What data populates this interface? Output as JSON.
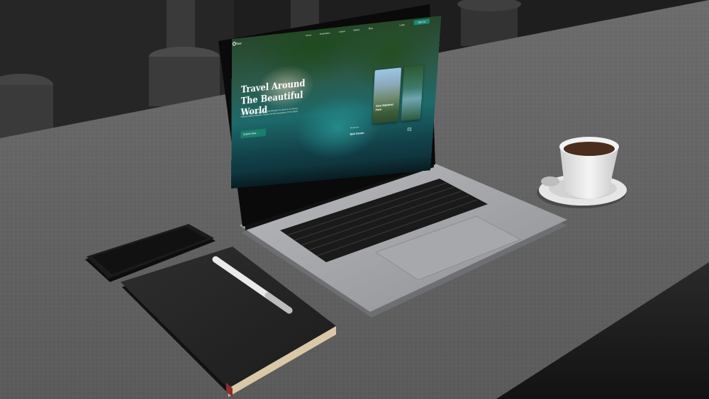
{
  "website": {
    "brand": "Tour",
    "nav_items": [
      "Home",
      "Destination",
      "Hotels",
      "Gallery",
      "Blog",
      "Login"
    ],
    "signup_label": "Sign Up",
    "hero_title_line1": "Travel Around",
    "hero_title_line2": "The Beautiful World",
    "hero_subtitle": "Look And Take Your Journey, See How Beautiful The World Is, Its Scenery Websites Without Hesitation. Browse The Best Destinations Of The World.",
    "explore_label": "Explore Now →",
    "card1_title": "Zion National Park",
    "featured_caption": "Bali Indonesia",
    "featured_title": "Bali Ocean",
    "slide_number": "01"
  },
  "colors": {
    "accent": "#1b7d6c",
    "desk": "#5e5e5e",
    "laptop_body": "#9a9ca0"
  }
}
